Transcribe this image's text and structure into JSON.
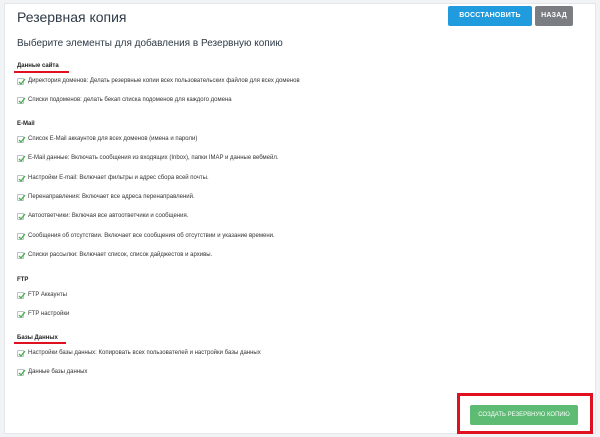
{
  "header": {
    "title": "Резервная копия",
    "restore_label": "ВОССТАНОВИТЬ БЕКАП",
    "back_label": "НАЗАД"
  },
  "subtitle": "Выберите элементы для добавления в Резервную копию",
  "sections": {
    "site": {
      "title": "Данные сайта",
      "items": [
        "Директория доменов: Делать резервные копии всех пользовательских файлов для всех доменов",
        "Списки подоменов: делать бекап списка подоменов для каждого домена"
      ]
    },
    "email": {
      "title": "E-Mail",
      "items": [
        "Список E-Mail аккаунтов для всех доменов (имена и пароли)",
        "E-Mail данные: Включать сообщения из входящих (Inbox), папки IMAP и данные вебмейл.",
        "Настройки E-mail: Включает фильтры и адрес сбора всей почты.",
        "Перенаправления: Включает все адреса перенаправлений.",
        "Автоответчики: Включая все автоответчики и сообщения.",
        "Сообщения об отсутствии. Включает все сообщения об отсутствии и указание времени.",
        "Списки рассылки: Включает список, список дайджестов и архивы."
      ]
    },
    "ftp": {
      "title": "FTP",
      "items": [
        "FTP Аккаунты",
        "FTP настройки"
      ]
    },
    "db": {
      "title": "Базы Данных",
      "items": [
        "Настройки базы данных: Копировать всех пользователей и настройки базы данных",
        "Данные базы данных"
      ]
    }
  },
  "footer": {
    "create_label": "СОЗДАТЬ РЕЗЕРВНУЮ КОПИЮ"
  },
  "colors": {
    "accent_blue": "#1f9bde",
    "back_gray": "#7a7e83",
    "create_green": "#5dbb74",
    "highlight_red": "#e01020",
    "check_green": "#4caf50"
  }
}
